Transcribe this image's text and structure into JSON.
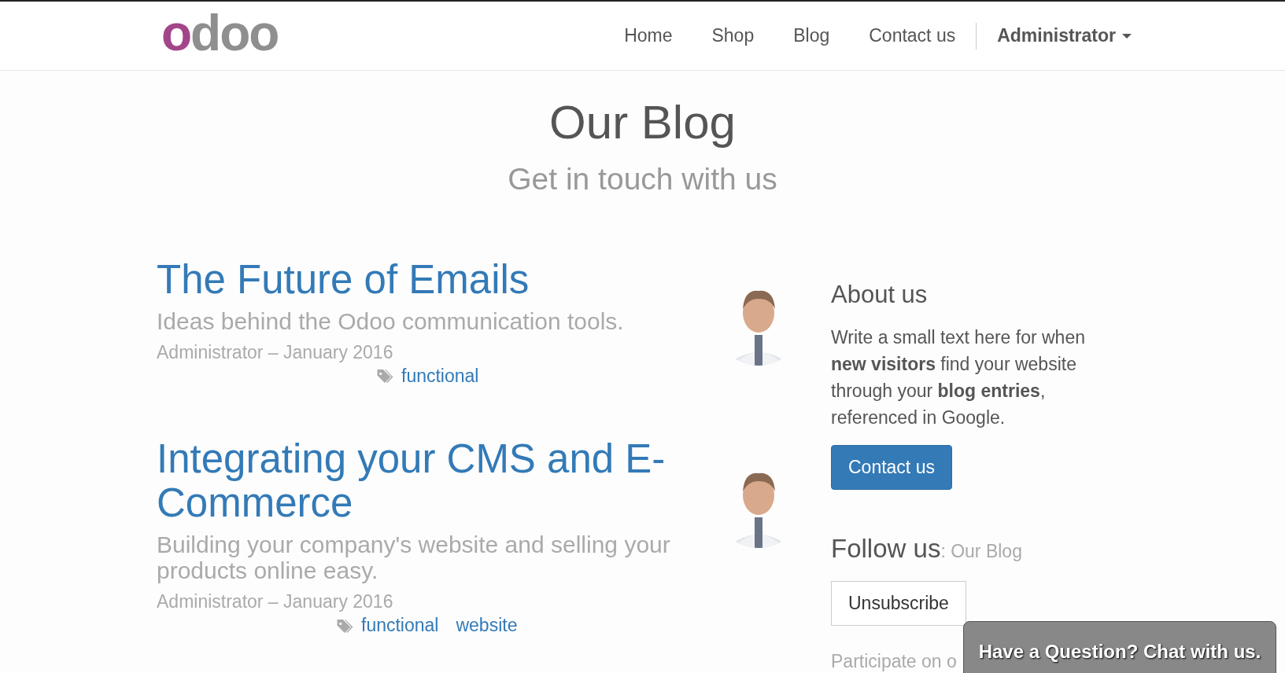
{
  "logo": "odoo",
  "nav": [
    {
      "label": "Home",
      "kind": "link"
    },
    {
      "label": "Shop",
      "kind": "link"
    },
    {
      "label": "Blog",
      "kind": "link"
    },
    {
      "label": "Contact us",
      "kind": "link"
    },
    {
      "label": "Administrator",
      "kind": "dropdown"
    }
  ],
  "header": {
    "title": "Our Blog",
    "subtitle": "Get in touch with us"
  },
  "posts": [
    {
      "title": "The Future of Emails",
      "subtitle": "Ideas behind the Odoo communication tools.",
      "meta": "Administrator – January 2016",
      "tags": [
        "functional"
      ]
    },
    {
      "title": "Integrating your CMS and E-Commerce",
      "subtitle": "Building your company's website and selling your products online easy.",
      "meta": "Administrator – January 2016",
      "tags": [
        "functional",
        "website"
      ]
    }
  ],
  "sidebar": {
    "about_title": "About us",
    "about_text": "Write a small text here for when **new visitors** find your website through your **blog entries**, referenced in Google.",
    "contact_button": "Contact us",
    "follow_title": "Follow us",
    "follow_subtitle": ": Our Blog",
    "unsubscribe_button": "Unsubscribe",
    "participate": "Participate on o"
  },
  "chat": "Have a Question? Chat with us."
}
